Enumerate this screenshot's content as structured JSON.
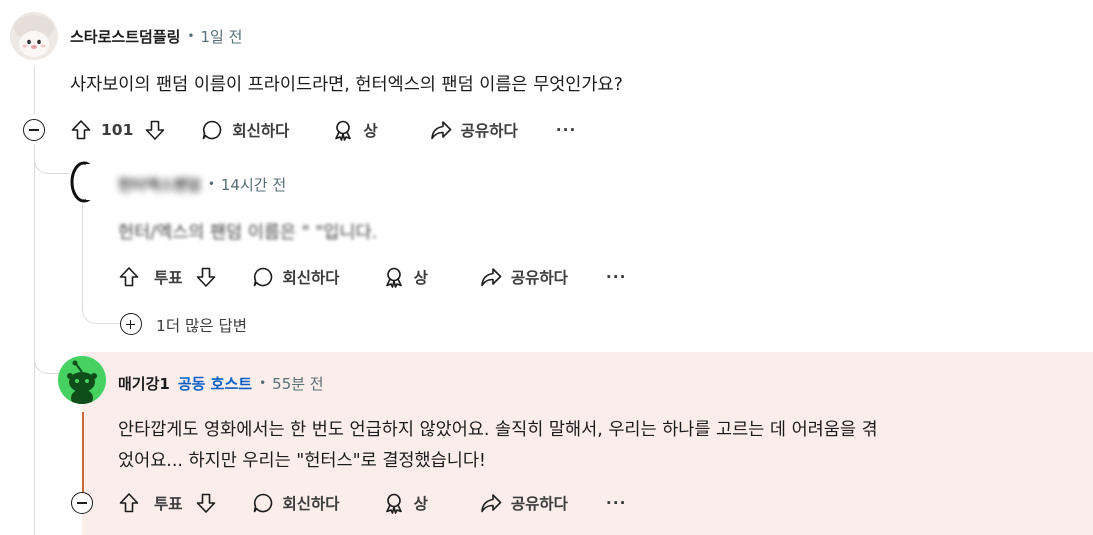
{
  "comments": [
    {
      "author": "스타로스트덤플링",
      "time": "1일 전",
      "text": "사자보이의 팬덤 이름이 프라이드라면, 헌터엑스의 팬덤 이름은 무엇인가요?",
      "vote_count": "101",
      "reply_label": "회신하다",
      "award_label": "상",
      "share_label": "공유하다",
      "more_label": "···"
    },
    {
      "author": "헌터엑스팬덤",
      "time": "14시간 전",
      "text": "헌터/엑스의 팬덤 이름은 \"                        \"입니다.",
      "vote_label": "투표",
      "reply_label": "회신하다",
      "award_label": "상",
      "share_label": "공유하다",
      "more_label": "···",
      "more_replies": "1더 많은 답변"
    },
    {
      "author": "매기강1",
      "badge": "공동 호스트",
      "time": "55분 전",
      "text_line1": "안타깝게도 영화에서는 한 번도 언급하지 않았어요. 솔직히 말해서, 우리는 하나를 고르는 데 어려움을 겪",
      "text_line2": "었어요... 하지만 우리는 \"헌터스\"로 결정했습니다!",
      "vote_label": "투표",
      "reply_label": "회신하다",
      "award_label": "상",
      "share_label": "공유하다",
      "more_label": "···"
    }
  ],
  "dot": "•",
  "colors": {
    "host_badge": "#0a5fc7",
    "highlight_bg": "#fbeeea",
    "avatar_green": "#46d160"
  },
  "icons": [
    "upvote-icon",
    "downvote-icon",
    "comment-icon",
    "award-icon",
    "share-icon",
    "collapse-icon",
    "expand-icon"
  ]
}
